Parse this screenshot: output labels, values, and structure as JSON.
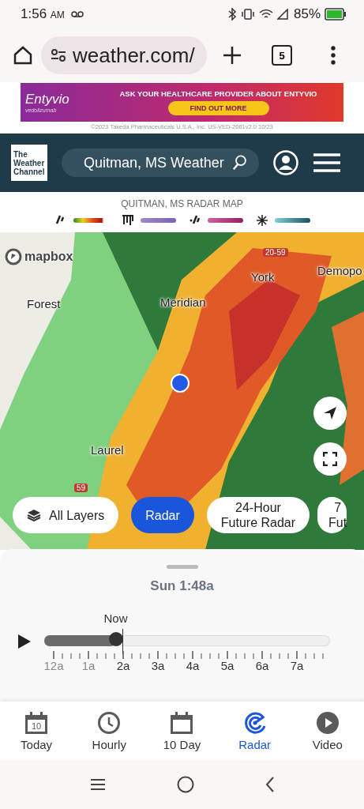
{
  "status_bar": {
    "time": "1:56",
    "ampm": "AM",
    "battery": "85%"
  },
  "browser": {
    "url": "weather.com/",
    "tab_count": "5"
  },
  "ad": {
    "brand": "Entyvio",
    "generic": "vedolizumab",
    "headline": "ASK YOUR HEALTHCARE PROVIDER ABOUT ENTYVIO",
    "button": "FIND OUT MORE",
    "disclaimer": "©2023 Takeda Pharmaceuticals U.S.A., Inc. US-VED-2061v2.0 10/23"
  },
  "header": {
    "logo": "The Weather Channel",
    "search": "Quitman, MS Weather"
  },
  "legend": {
    "title": "QUITMAN, MS RADAR MAP",
    "items": [
      {
        "kind": "rain"
      },
      {
        "kind": "ice"
      },
      {
        "kind": "mix"
      },
      {
        "kind": "snow"
      }
    ]
  },
  "map": {
    "attribution": "mapbox",
    "labels": [
      {
        "text": "20-59",
        "kind": "shield"
      },
      {
        "text": "York",
        "kind": "city"
      },
      {
        "text": "Demopo",
        "kind": "city"
      },
      {
        "text": "Forest",
        "kind": "city"
      },
      {
        "text": "Meridian",
        "kind": "city"
      },
      {
        "text": "Laurel",
        "kind": "city"
      },
      {
        "text": "59",
        "kind": "shield"
      }
    ]
  },
  "layers": [
    {
      "lines": [
        "All Layers"
      ],
      "icon": true,
      "selected": false
    },
    {
      "lines": [
        "Radar"
      ],
      "icon": false,
      "selected": true
    },
    {
      "lines": [
        "24-Hour",
        "Future Radar"
      ],
      "icon": false,
      "selected": false
    },
    {
      "lines": [
        "7",
        "Fut"
      ],
      "icon": false,
      "selected": false
    }
  ],
  "timeline": {
    "time": "Sun 1:48a",
    "now": "Now",
    "level": 0.25,
    "ticks": [
      {
        "label": "12a",
        "past": true
      },
      {
        "label": "1a",
        "past": true
      },
      {
        "label": "2a",
        "past": false
      },
      {
        "label": "3a",
        "past": false
      },
      {
        "label": "4a",
        "past": false
      },
      {
        "label": "5a",
        "past": false
      },
      {
        "label": "6a",
        "past": false
      },
      {
        "label": "7a",
        "past": false
      }
    ]
  },
  "nav": [
    {
      "label": "Today",
      "kind": "today",
      "icon_text": "10",
      "selected": false
    },
    {
      "label": "Hourly",
      "kind": "hourly",
      "selected": false
    },
    {
      "label": "10 Day",
      "kind": "tenday",
      "selected": false
    },
    {
      "label": "Radar",
      "kind": "radar",
      "selected": true
    },
    {
      "label": "Video",
      "kind": "video",
      "selected": false
    }
  ]
}
